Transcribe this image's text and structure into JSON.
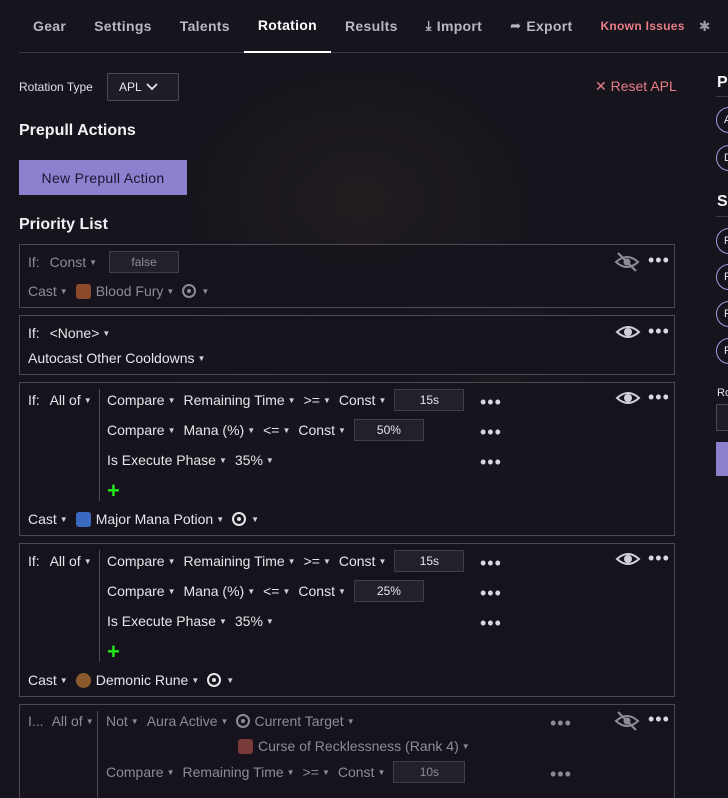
{
  "nav": {
    "tabs": [
      {
        "label": "Gear"
      },
      {
        "label": "Settings"
      },
      {
        "label": "Talents"
      },
      {
        "label": "Rotation"
      },
      {
        "label": "Results"
      },
      {
        "label": "Import",
        "icon": "download-icon"
      },
      {
        "label": "Export",
        "icon": "export-icon"
      }
    ],
    "active_tab": "Rotation",
    "known_issues": "Known Issues",
    "bug_icon": "bug-icon"
  },
  "rotation": {
    "type_label": "Rotation Type",
    "type_value": "APL",
    "reset_label": "Reset APL",
    "prepull_title": "Prepull Actions",
    "new_prepull_label": "New Prepull Action",
    "priority_title": "Priority List"
  },
  "cards": {
    "c1": {
      "if_label": "If:",
      "cond": "Const",
      "cond_value": "false",
      "action": "Cast",
      "spell": "Blood Fury",
      "spell_icon_color": "#8a4a2a",
      "visibility": "hidden"
    },
    "c2": {
      "if_label": "If:",
      "cond": "<None>",
      "action": "Autocast Other Cooldowns",
      "visibility": "visible"
    },
    "c3": {
      "if_label": "If:",
      "group": "All of",
      "rows": [
        {
          "kind": "Compare",
          "lhs": "Remaining Time",
          "op": ">=",
          "rhs": "Const",
          "value": "15s"
        },
        {
          "kind": "Compare",
          "lhs": "Mana (%)",
          "op": "<=",
          "rhs": "Const",
          "value": "50%"
        },
        {
          "kind": "Is Execute Phase",
          "value": "35%"
        }
      ],
      "action": "Cast",
      "spell": "Major Mana Potion",
      "spell_icon_color": "#3a6ac0",
      "visibility": "visible"
    },
    "c4": {
      "if_label": "If:",
      "group": "All of",
      "rows": [
        {
          "kind": "Compare",
          "lhs": "Remaining Time",
          "op": ">=",
          "rhs": "Const",
          "value": "15s"
        },
        {
          "kind": "Compare",
          "lhs": "Mana (%)",
          "op": "<=",
          "rhs": "Const",
          "value": "25%"
        },
        {
          "kind": "Is Execute Phase",
          "value": "35%"
        }
      ],
      "action": "Cast",
      "spell": "Demonic Rune",
      "spell_icon_color": "#8a5a2a",
      "visibility": "visible"
    },
    "c5": {
      "if_label": "I...",
      "group": "All of",
      "not_label": "Not",
      "aura": "Aura Active",
      "target": "Current Target",
      "aura_spell": "Curse of Recklessness (Rank 4)",
      "aura_icon_color": "#7a3a3a",
      "row2": {
        "kind": "Compare",
        "lhs": "Remaining Time",
        "op": ">=",
        "rhs": "Const",
        "value": "10s"
      },
      "visibility": "hidden"
    }
  },
  "colors": {
    "accent": "#8e7fcf",
    "danger": "#e87d87",
    "add": "#22e81c",
    "background": "#16141c"
  }
}
